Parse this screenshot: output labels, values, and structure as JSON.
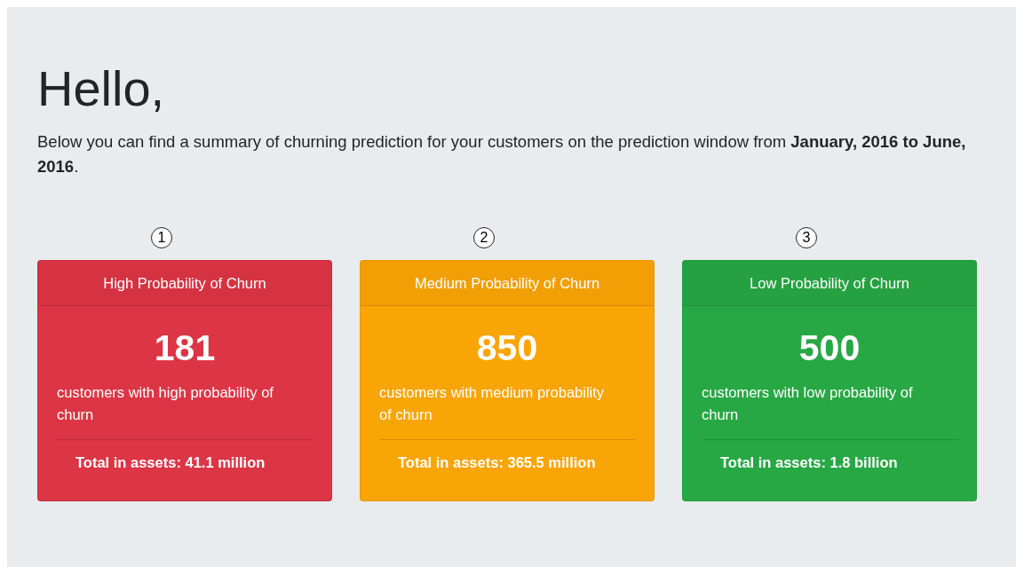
{
  "greeting": "Hello,",
  "intro": "Below you can find a summary of churning prediction for your customers on the prediction window from **January, 2016 to June, 2016**.",
  "cards": [
    {
      "marker": "1",
      "title": "High Probability of Churn",
      "count": "181",
      "description": "customers with high probability of churn",
      "total": "Total in assets: 41.1 million",
      "color": "#dc3545"
    },
    {
      "marker": "2",
      "title": "Medium Probability of Churn",
      "count": "850",
      "description": "customers with medium probability of churn",
      "total": "Total in assets: 365.5 million",
      "color": "#f9a505"
    },
    {
      "marker": "3",
      "title": "Low Probability of Churn",
      "count": "500",
      "description": "customers with low probability of churn",
      "total": "Total in assets: 1.8 billion",
      "color": "#28a745"
    }
  ]
}
